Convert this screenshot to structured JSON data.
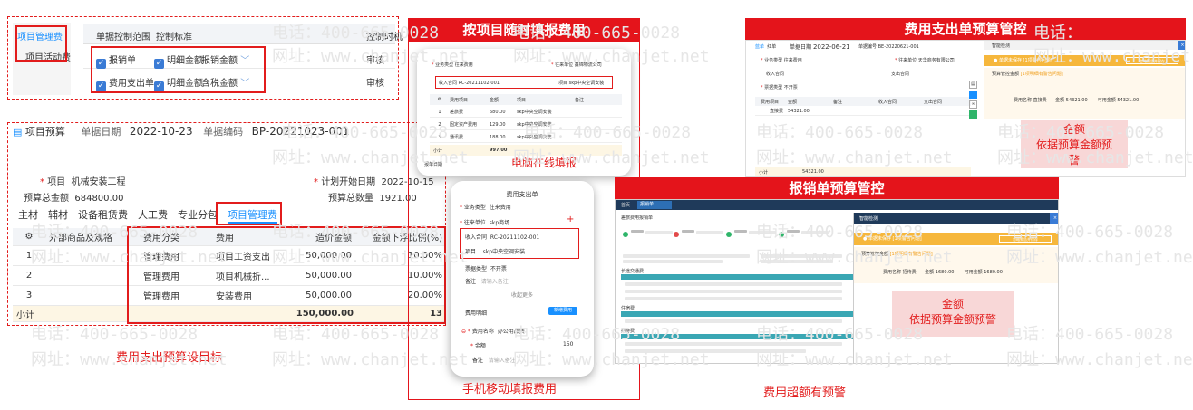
{
  "top_panel": {
    "tab_active": "项目管理费",
    "tab_2": "项目活动费",
    "col_range": "单据控制范围",
    "col_standard": "控制标准",
    "col_timing": "控制时机",
    "row1": {
      "doc": "报销单",
      "std": "明细金额",
      "amount": "报销金额",
      "timing": "审核"
    },
    "row2": {
      "doc": "费用支出单",
      "std": "明细金额",
      "amount": "含税金额",
      "timing": "审核"
    }
  },
  "budget_form": {
    "title": "项目预算",
    "date_label": "单据日期",
    "date": "2022-10-23",
    "code_label": "单据编码",
    "code": "BP-20221023-001",
    "project_label": "项目",
    "project": "机械安装工程",
    "start_label": "计划开始日期",
    "start": "2022-10-15",
    "total_amount_label": "预算总金额",
    "total_amount": "684800.00",
    "total_qty_label": "预算总数量",
    "total_qty": "1921.00",
    "tabs": [
      "主材",
      "辅材",
      "设备租赁费",
      "人工费",
      "专业分包",
      "项目管理费"
    ],
    "headers": [
      "外部商品及规格",
      "费用分类",
      "费用",
      "造价金额",
      "金额下浮比例(%)"
    ],
    "rows": [
      {
        "no": "1",
        "cat": "管理费用",
        "fee": "项目工资支出",
        "amt": "50,000.00",
        "pct": "10.00%"
      },
      {
        "no": "2",
        "cat": "管理费用",
        "fee": "项目机械折...",
        "amt": "50,000.00",
        "pct": "10.00%"
      },
      {
        "no": "3",
        "cat": "管理费用",
        "fee": "安装费用",
        "amt": "50,000.00",
        "pct": "20.00%"
      }
    ],
    "subtotal_label": "小计",
    "subtotal": "150,000.00",
    "subtotal_right": "13"
  },
  "captions": {
    "budget_goal": "费用支出预算设目标",
    "by_project": "按项目随时填报费用",
    "pc_fill": "电脑在线填报",
    "mobile_fill": "手机移动填报费用",
    "expense_control": "费用支出单预算管控",
    "reimb_control": "报销单预算管控",
    "overrun_warning": "费用超额有预警",
    "warn_right_1": "金额",
    "warn_right_2": "依据预算金额预",
    "warn_right_3": "警",
    "warn_mid_1": "金额",
    "warn_mid_2": "依据预算金额预警"
  },
  "pc_form": {
    "biz_label": "业务类型",
    "biz": "往来费用",
    "partner_label": "往来单位",
    "partner": "鑫锦物流公司",
    "contract_label": "收入合同",
    "contract": "RC-20211102-001",
    "project_label": "项目",
    "project": "skp中央空调安装",
    "headers": [
      "费用项目",
      "金额",
      "项目",
      "备注"
    ],
    "rows": [
      {
        "no": "1",
        "name": "差旅费",
        "amt": "680.00",
        "proj": "skp中央空调安装"
      },
      {
        "no": "2",
        "name": "固定资产费用",
        "amt": "129.00",
        "proj": "skp中央空调安装"
      },
      {
        "no": "3",
        "name": "通讯费",
        "amt": "188.00",
        "proj": "skp中央空调安装"
      }
    ],
    "subtotal_label": "小计",
    "subtotal": "997.00",
    "bottom_label": "报单日期"
  },
  "mobile_form": {
    "title": "费用支出单",
    "biz_label": "业务类型",
    "biz": "往来费用",
    "partner_label": "往来单位",
    "partner": "skp商场",
    "contract_label": "收入合同",
    "contract": "RC-20211102-001",
    "project_label": "项目",
    "project": "skp中央空调安装",
    "invoice_label": "票据类型",
    "invoice": "不开票",
    "note_label": "备注",
    "note_ph": "请输入备注",
    "collapse": "收起更多",
    "detail_label": "费用明细",
    "detail_btn": "新增费用",
    "fee_name_label": "费用名称",
    "fee_name": "办公用品费",
    "amount_label": "金额",
    "amount": "150",
    "note2_label": "备注",
    "note2_ph": "请输入备注"
  },
  "expense_window": {
    "tab1": "蓝单",
    "tab2": "红单",
    "date_label": "单据日期",
    "date": "2022-06-21",
    "code_label": "单据编号",
    "code": "BE-20220621-001",
    "biz_label": "业务类型",
    "biz": "往来费用",
    "partner_label": "往来单位",
    "partner": "天华商务有限公司",
    "contract_label": "收入合同",
    "pay_label": "支出合同",
    "invoice_label": "票据类型",
    "invoice": "不开票",
    "col_fee": "费用项目",
    "col_amt": "金额",
    "col_note": "备注",
    "col_income": "收入合同",
    "col_out": "支出合同",
    "row1_name": "直接费",
    "row1_amt": "54321.00",
    "subtotal_label": "小计",
    "subtotal": "54321.00",
    "side_title": "智能检测",
    "warn_bar": "单据未保存 [1项警告问题]",
    "warn_btn": "忽略警告并保存",
    "rule": "预算管控金额",
    "rule_detail": "[1项明细有警告问题]",
    "line_label": "费用名称",
    "line_name": "直接费",
    "line_amt_label": "金额",
    "line_amt": "54321.00",
    "line_budget_label": "可用金额",
    "line_budget": "54321.00"
  },
  "reimb_window": {
    "tab_home": "首页",
    "tab_active": "报销单",
    "doc_title": "差旅费用报销单",
    "side_title": "智能检测",
    "warn_bar": "单据未保存 [1项警告问题]",
    "warn_btn": "忽略警告并保存",
    "rule": "预算管控金额",
    "rule_detail": "[1项明细有警告问题]",
    "line_label": "费用名称",
    "line_name": "招待费",
    "line_amt_label": "金额",
    "line_amt": "1680.00",
    "line_budget_label": "可用金额",
    "line_budget": "1680.00",
    "sec1": "长途交通费",
    "sec2": "住宿费",
    "sec3": "招待费"
  },
  "watermarks": {
    "phone": "电话：400-665-0028",
    "phone_short": "电话：",
    "site": "网址：www.chanjet.net"
  },
  "colors": {
    "accent_red": "#e4141b",
    "accent_blue": "#1890ff",
    "orange": "#f0a020"
  }
}
